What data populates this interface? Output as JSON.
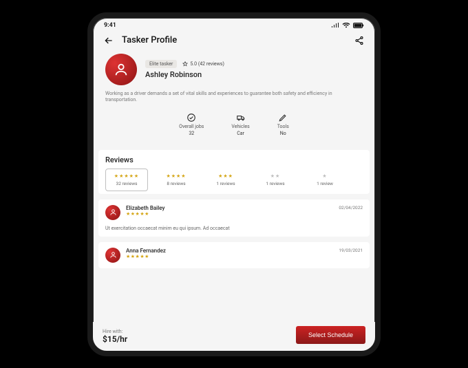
{
  "status": {
    "time": "9:41"
  },
  "header": {
    "title": "Tasker Profile"
  },
  "profile": {
    "badge": "Elite tasker",
    "rating_text": "5.0 (42 reviews)",
    "name": "Ashley Robinson",
    "bio": "Working as a driver demands a set of vital skills and experiences to guarantee both safety and efficiency in transportation."
  },
  "stats": [
    {
      "label": "Overall jobs",
      "value": "32"
    },
    {
      "label": "Vehicles",
      "value": "Car"
    },
    {
      "label": "Tools",
      "value": "No"
    }
  ],
  "reviews": {
    "title": "Reviews",
    "filters": [
      {
        "stars": 5,
        "count_label": "32 reviews",
        "selected": true
      },
      {
        "stars": 4,
        "count_label": "8 reviews"
      },
      {
        "stars": 3,
        "count_label": "1 reviews"
      },
      {
        "stars": 2,
        "count_label": "1 reviews"
      },
      {
        "stars": 1,
        "count_label": "1 review"
      }
    ],
    "items": [
      {
        "name": "Elizabeth Bailey",
        "date": "02/04/2022",
        "text": "Ut exercitation occaecat minim eu qui ipsum. Ad occaecat"
      },
      {
        "name": "Anna Fernandez",
        "date": "19/03/2021",
        "text": ""
      }
    ]
  },
  "footer": {
    "hire_label": "Hire with:",
    "rate": "$15/hr",
    "cta": "Select Schedule"
  }
}
